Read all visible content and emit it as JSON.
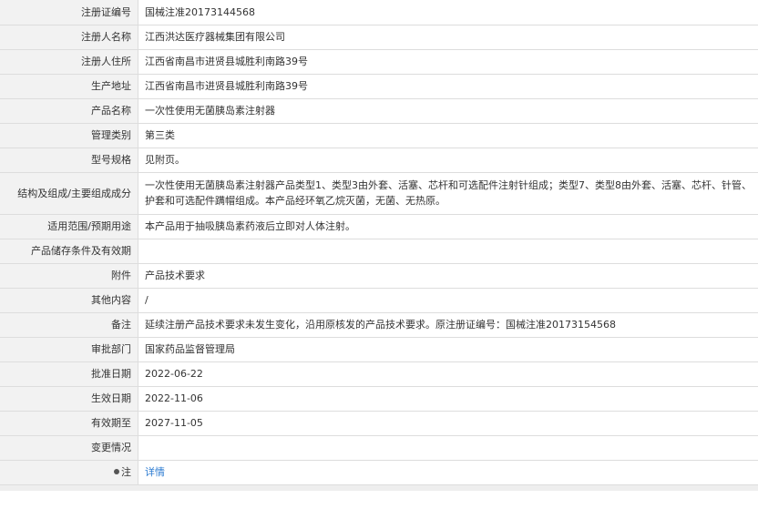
{
  "rows": [
    {
      "label": "注册证编号",
      "value": "国械注准20173144568"
    },
    {
      "label": "注册人名称",
      "value": "江西洪达医疗器械集团有限公司"
    },
    {
      "label": "注册人住所",
      "value": "江西省南昌市进贤县城胜利南路39号"
    },
    {
      "label": "生产地址",
      "value": "江西省南昌市进贤县城胜利南路39号"
    },
    {
      "label": "产品名称",
      "value": "一次性使用无菌胰岛素注射器"
    },
    {
      "label": "管理类别",
      "value": "第三类"
    },
    {
      "label": "型号规格",
      "value": "见附页。"
    },
    {
      "label": "结构及组成/主要组成成分",
      "value": "一次性使用无菌胰岛素注射器产品类型1、类型3由外套、活塞、芯杆和可选配件注射针组成；类型7、类型8由外套、活塞、芯杆、针管、护套和可选配件蹒帽组成。本产品经环氧乙烷灭菌，无菌、无热原。"
    },
    {
      "label": "适用范围/预期用途",
      "value": "本产品用于抽吸胰岛素药液后立即对人体注射。"
    },
    {
      "label": "产品储存条件及有效期",
      "value": ""
    },
    {
      "label": "附件",
      "value": "产品技术要求"
    },
    {
      "label": "其他内容",
      "value": "/"
    },
    {
      "label": "备注",
      "value": "延续注册产品技术要求未发生变化，沿用原核发的产品技术要求。原注册证编号：国械注准20173154568"
    },
    {
      "label": "审批部门",
      "value": "国家药品监督管理局"
    },
    {
      "label": "批准日期",
      "value": "2022-06-22"
    },
    {
      "label": "生效日期",
      "value": "2022-11-06"
    },
    {
      "label": "有效期至",
      "value": "2027-11-05"
    },
    {
      "label": "变更情况",
      "value": ""
    }
  ],
  "note_row": {
    "label": "注",
    "icon": "pin-icon",
    "link": "详情"
  }
}
